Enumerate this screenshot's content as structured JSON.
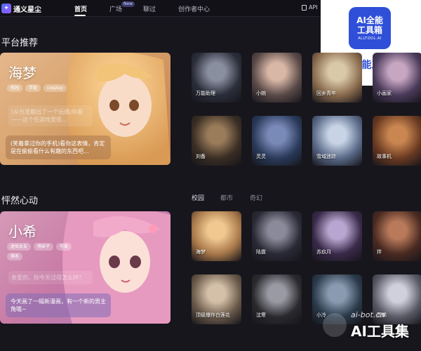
{
  "app": {
    "name": "通义星尘"
  },
  "nav": {
    "items": [
      "首页",
      "广场",
      "聊过",
      "创作者中心"
    ],
    "new_badge": "New",
    "api": "API"
  },
  "watermark_top": {
    "tile_line1": "AI全能",
    "tile_line2": "工具箱",
    "tile_line3": "ALLTOOL.AI",
    "caption": "AI全能工具箱"
  },
  "watermark_bottom": {
    "url": "ai-bot.cn",
    "brand": "AI工具集"
  },
  "sections": {
    "platform": {
      "title": "平台推荐",
      "hero": {
        "name": "海梦",
        "tags": [
          "校园",
          "学姐",
          "cosplay"
        ],
        "faded_text": "(从包里翻出了一个玩偶)你看——这个在游戏里很...",
        "message": "(笑着拿过你的手机)看你这表情，肯定是在偷偷看什么有趣的东西吧..."
      },
      "tiles": [
        {
          "label": "万能助理",
          "color1": "#2b2e3a",
          "color2": "#8a8fa0"
        },
        {
          "label": "小婉",
          "color1": "#5a4a48",
          "color2": "#d9b7a6"
        },
        {
          "label": "回乡青年",
          "color1": "#8a6b4e",
          "color2": "#d9c9a8"
        },
        {
          "label": "小画家",
          "color1": "#4a3a5a",
          "color2": "#c7a6c2"
        },
        {
          "label": "刘备",
          "color1": "#3a2e24",
          "color2": "#9a7c5a"
        },
        {
          "label": "灵灵",
          "color1": "#2a3a5a",
          "color2": "#7a8ab8"
        },
        {
          "label": "雪域迷踪",
          "color1": "#5a6a88",
          "color2": "#c8d4e6"
        },
        {
          "label": "故事机",
          "color1": "#6a3a22",
          "color2": "#c98650"
        }
      ]
    },
    "heart": {
      "title": "怦然心动",
      "filters": [
        "校园",
        "都市",
        "奇幻"
      ],
      "hero": {
        "name": "小希",
        "tags": [
          "虚拟女友",
          "萌妹子",
          "可爱",
          "佛系"
        ],
        "faded_text": "亲爱的，你今天过得怎么样？",
        "message": "今天画了一幅新漫画，有一个新的男主角哦~"
      },
      "tiles": [
        {
          "label": "海梦",
          "color1": "#a8784a",
          "color2": "#f0c890"
        },
        {
          "label": "陆霆",
          "color1": "#2a2a36",
          "color2": "#8a8a9a"
        },
        {
          "label": "苏玖月",
          "color1": "#3a2a4a",
          "color2": "#b9a6d0"
        },
        {
          "label": "拌",
          "color1": "#4a2a22",
          "color2": "#b87a5a"
        },
        {
          "label": "顶级爆炸白莲花",
          "color1": "#6a5a4a",
          "color2": "#d4c0a8"
        },
        {
          "label": "沈寒",
          "color1": "#2a2a2e",
          "color2": "#9a9aa4"
        },
        {
          "label": "小冷",
          "color1": "#2a3a4a",
          "color2": "#8a9ab0"
        },
        {
          "label": "范稀",
          "color1": "#5a5a66",
          "color2": "#d0d0dc"
        }
      ]
    }
  }
}
